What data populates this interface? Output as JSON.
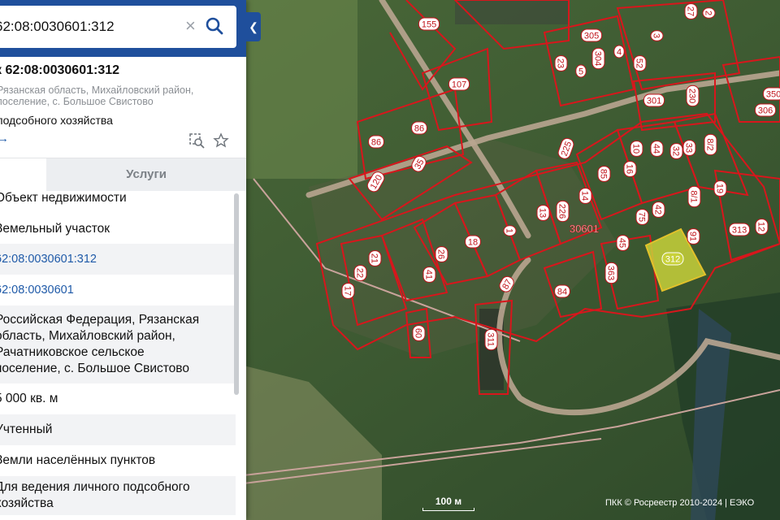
{
  "search": {
    "value": "62:08:0030601:312",
    "clear_icon": "close-icon",
    "search_icon": "search-icon"
  },
  "collapse_icon": "chevron-left-icon",
  "card": {
    "title": "к 62:08:0030601:312",
    "address_lines": [
      "Рязанская область, Михайловский район,",
      "поселение, с. Большое Свистово"
    ],
    "purpose": "подсобного хозяйства",
    "arrow": "→"
  },
  "tabs": {
    "active": "",
    "services": "Услуги"
  },
  "attributes": [
    {
      "value": "Объект недвижимости",
      "kind": "text"
    },
    {
      "value": "Земельный участок",
      "kind": "text"
    },
    {
      "value": "62:08:0030601:312",
      "kind": "link"
    },
    {
      "value": "62:08:0030601",
      "kind": "link"
    },
    {
      "value": "Российская Федерация, Рязанская область, Михайловский район, Рачатниковское сельское поселение, с. Большое Свистово",
      "kind": "multiline",
      "lines": [
        "Российская Федерация, Рязанская",
        "область, Михайловский район,",
        "Рачатниковское сельское",
        "поселение, с. Большое Свистово"
      ]
    },
    {
      "value": "5 000 кв. м",
      "kind": "text"
    },
    {
      "value": "Учтенный",
      "kind": "text"
    },
    {
      "value": "Земли населённых пунктов",
      "kind": "text"
    },
    {
      "value": "Для ведения личного подсобного хозяйства",
      "kind": "multiline",
      "lines": [
        "Для ведения личного подсобного",
        "хозяйства"
      ]
    }
  ],
  "map": {
    "quarter_label": "30601",
    "selected_parcel": "312",
    "parcel_labels": [
      "155",
      "305",
      "3",
      "27",
      "2",
      "23",
      "5",
      "304",
      "4",
      "52",
      "107",
      "301",
      "230",
      "350",
      "306",
      "86",
      "86",
      "225",
      "10",
      "44",
      "32",
      "33",
      "8/2",
      "120",
      "35",
      "85",
      "16",
      "14",
      "13",
      "226",
      "42",
      "8/1",
      "19",
      "1",
      "18",
      "26",
      "41",
      "21",
      "22",
      "17",
      "60",
      "311",
      "87",
      "84",
      "45",
      "75",
      "91",
      "313",
      "12",
      "363"
    ],
    "scale": "100 м",
    "attribution": "ПКК © Росреестр 2010-2024 | ЕЭКО"
  },
  "colors": {
    "header": "#1f4f9c",
    "parcel_border": "#d8161c",
    "selected_fill": "#c8d13a",
    "link": "#1f5aa8"
  }
}
